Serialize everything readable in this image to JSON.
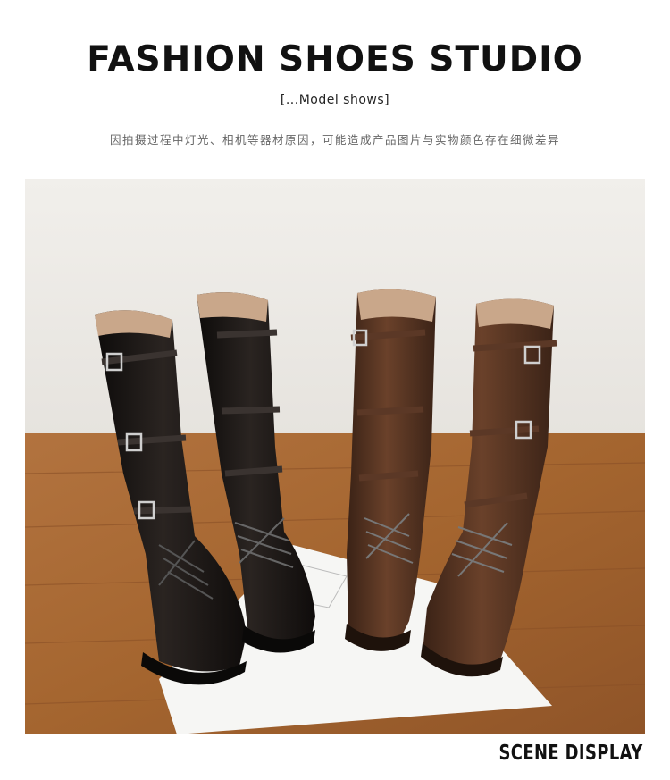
{
  "header": {
    "title": "FASHION SHOES STUDIO",
    "subtitle": "[...Model shows]",
    "notice": "因拍摄过程中灯光、相机等器材原因，可能造成产品图片与实物颜色存在细微差异"
  },
  "photo": {
    "subject": "four-knee-high-lace-up-buckle-boots",
    "colors": {
      "wall": "#eeece8",
      "floor": "#a8693a",
      "black_boot": "#1a1613",
      "brown_boot": "#4a2c1c"
    }
  },
  "footer": {
    "label": "SCENE DISPLAY"
  }
}
